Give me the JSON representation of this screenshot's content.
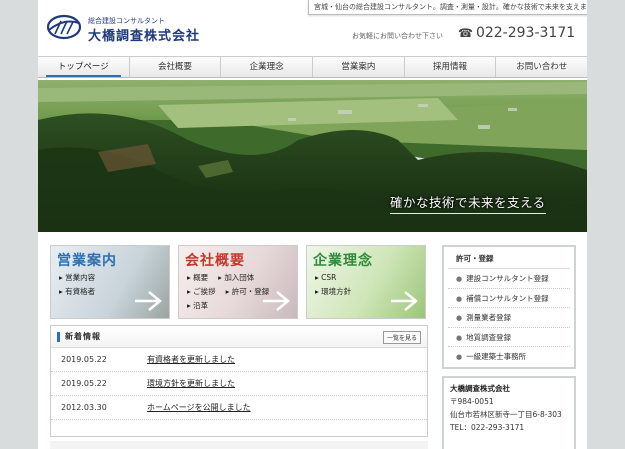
{
  "tagline": "宮城・仙台の総合建設コンサルタント。調査・測量・設計。確かな技術で未来を支えます。",
  "header": {
    "logo_sub": "総合建設コンサルタント",
    "logo_name": "大橋調査株式会社",
    "contact_text": "お気軽にお問い合わせ下さい",
    "phone": "022-293-3171"
  },
  "nav": {
    "items": [
      {
        "label": "トップページ"
      },
      {
        "label": "会社概要"
      },
      {
        "label": "企業理念"
      },
      {
        "label": "営業案内"
      },
      {
        "label": "採用情報"
      },
      {
        "label": "お問い合わせ"
      }
    ]
  },
  "hero": {
    "caption": "確かな技術で未来を支える"
  },
  "cards": [
    {
      "title": "営業案内",
      "links": [
        "営業内容",
        "有資格者"
      ],
      "color": "#2d6fb0"
    },
    {
      "title": "会社概要",
      "links": [
        "概要",
        "加入団体",
        "ご挨拶",
        "許可・登録",
        "沿革"
      ],
      "color": "#c0392b"
    },
    {
      "title": "企業理念",
      "links": [
        "CSR",
        "環境方針"
      ],
      "color": "#2f8a3a"
    }
  ],
  "news": {
    "title": "新着情報",
    "more": "一覧を見る",
    "items": [
      {
        "date": "2019.05.22",
        "text": "有資格者を更新しました"
      },
      {
        "date": "2019.05.22",
        "text": "環境方針を更新しました"
      },
      {
        "date": "2012.03.30",
        "text": "ホームページを公開しました"
      }
    ]
  },
  "sidebar": {
    "license_title": "許可・登録",
    "license_items": [
      "建設コンサルタント登録",
      "補償コンサルタント登録",
      "測量業者登録",
      "地質調査登録",
      "一級建築士事務所"
    ],
    "company_name": "大橋調査株式会社",
    "postal": "〒984-0051",
    "address": "仙台市若林区新寺一丁目6-8-303",
    "tel": "TEL：022-293-3171"
  }
}
